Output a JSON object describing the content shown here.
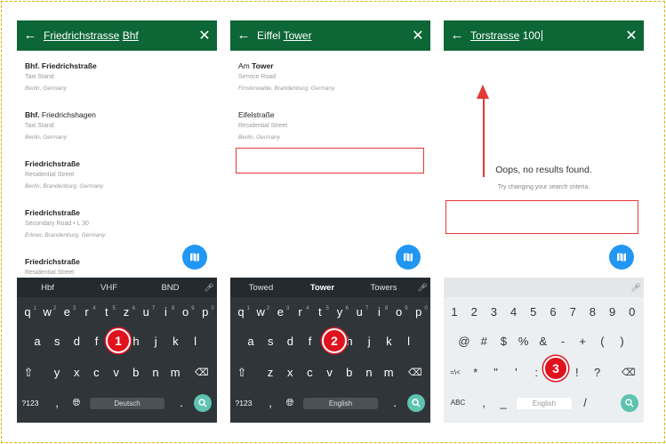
{
  "panels": [
    {
      "query_plain": "Friedrichstrasse",
      "query_underlined": "Bhf",
      "results": [
        {
          "pre": "Bhf.",
          "title": " Friedrichstraße",
          "sub": "Taxi Stand",
          "loc": "Berlin, Germany"
        },
        {
          "pre": "Bhf.",
          "title": " Friedrichshagen",
          "sub": "Taxi Stand",
          "loc": "Berlin, Germany"
        },
        {
          "pre": "",
          "title": "Friedrichstraße",
          "sub": "Residential Street",
          "loc": "Berlin, Brandenburg, Germany"
        },
        {
          "pre": "",
          "title": "Friedrichstraße",
          "sub": "Secondary Road • L 30",
          "loc": "Erkner, Brandenburg, Germany"
        },
        {
          "pre": "",
          "title": "Friedrichstraße",
          "sub": "Residential Street",
          "loc": ""
        }
      ],
      "suggestions": [
        "Hbf",
        "VHF",
        "BND"
      ],
      "keys_row1": [
        "q",
        "w",
        "e",
        "r",
        "t",
        "z",
        "u",
        "i",
        "o",
        "p"
      ],
      "keys_row1_sup": [
        "1",
        "2",
        "3",
        "4",
        "5",
        "6",
        "7",
        "8",
        "9",
        "0"
      ],
      "keys_row2": [
        "a",
        "s",
        "d",
        "f",
        "g",
        "h",
        "j",
        "k",
        "l"
      ],
      "keys_row3": [
        "y",
        "x",
        "c",
        "v",
        "b",
        "n",
        "m"
      ],
      "sym_label": "?123",
      "comma": ",",
      "period": ".",
      "space_label": "Deutsch",
      "step": "1"
    },
    {
      "query_plain": "Eiffel",
      "query_underlined": "Tower",
      "results": [
        {
          "pre": "Am",
          "title": " Tower",
          "sub": "Service Road",
          "loc": "Finsterwalde, Brandenburg, Germany"
        },
        {
          "pre": "",
          "title": "Eifelstraße",
          "sub": "Residential Street",
          "loc": "Berlin, Germany"
        }
      ],
      "suggestions": [
        "Towed",
        "Tower",
        "Towers"
      ],
      "keys_row1": [
        "q",
        "w",
        "e",
        "r",
        "t",
        "y",
        "u",
        "i",
        "o",
        "p"
      ],
      "keys_row1_sup": [
        "1",
        "2",
        "3",
        "4",
        "5",
        "6",
        "7",
        "8",
        "9",
        "0"
      ],
      "keys_row2": [
        "a",
        "s",
        "d",
        "f",
        "g",
        "h",
        "j",
        "k",
        "l"
      ],
      "keys_row3": [
        "z",
        "x",
        "c",
        "v",
        "b",
        "n",
        "m"
      ],
      "sym_label": "?123",
      "comma": ",",
      "period": ".",
      "space_label": "English",
      "step": "2"
    },
    {
      "query_plain": "Torstrasse",
      "query_suffix": "100",
      "empty_title": "Oops, no results found.",
      "empty_sub": "Try changing your search criteria.",
      "num_row": [
        "1",
        "2",
        "3",
        "4",
        "5",
        "6",
        "7",
        "8",
        "9",
        "0"
      ],
      "sym_row2": [
        "@",
        "#",
        "$",
        "%",
        "&",
        "-",
        "+",
        "(",
        ")"
      ],
      "sym_row3": [
        "=\\<",
        "*",
        "\"",
        "'",
        ":",
        ";",
        "!",
        "?"
      ],
      "abc_label": "ABC",
      "comma": ",",
      "underscore": "_",
      "slash": "/",
      "space_label": "English",
      "step": "3"
    }
  ],
  "colors": {
    "topbar": "#0c6636",
    "fab": "#2196f3",
    "badge": "#e0121e",
    "highlight": "#e53935",
    "search_key": "#5ec3b0"
  }
}
